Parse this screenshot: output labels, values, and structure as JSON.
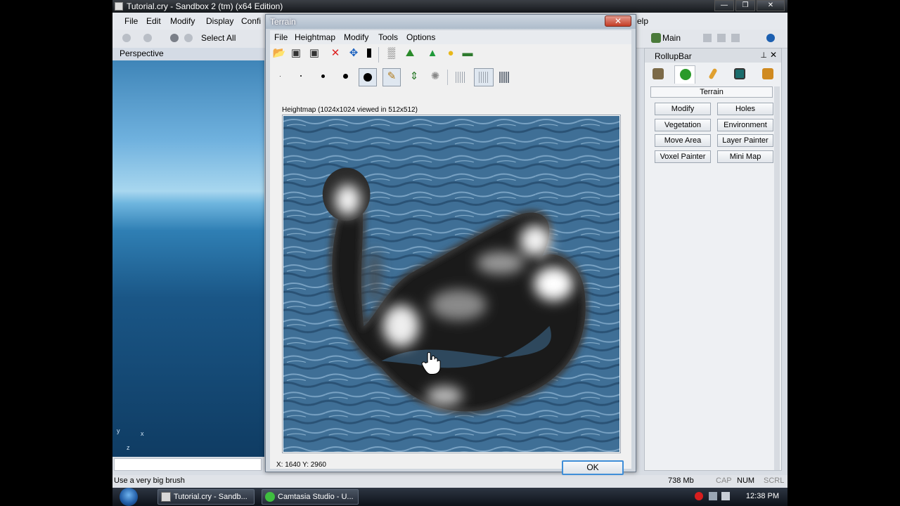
{
  "app": {
    "title": "Tutorial.cry - Sandbox 2 (tm) (x64 Edition)",
    "menus": [
      "File",
      "Edit",
      "Modify",
      "Display",
      "Confi",
      "elp"
    ],
    "toolbar": {
      "select_all": "Select All",
      "main_label": "Main"
    },
    "viewport_label": "Perspective",
    "axis": {
      "y": "y",
      "x": "x",
      "z": "z"
    },
    "status": {
      "text": "Use a very big brush",
      "memory": "738 Mb",
      "cap": "CAP",
      "num": "NUM",
      "scrl": "SCRL"
    }
  },
  "rollup": {
    "title": "RollupBar",
    "section": "Terrain",
    "buttons": [
      "Modify",
      "Holes",
      "Vegetation",
      "Environment",
      "Move Area",
      "Layer Painter",
      "Voxel Painter",
      "Mini Map"
    ]
  },
  "terrain_dialog": {
    "title": "Terrain",
    "close_glyph": "✕",
    "menus": [
      "File",
      "Heightmap",
      "Modify",
      "Tools",
      "Options"
    ],
    "caption": "Heightmap (1024x1024 viewed in 512x512)",
    "coords": "X: 1640 Y: 2960",
    "ok": "OK"
  },
  "taskbar": {
    "items": [
      "Tutorial.cry - Sandb...",
      "Camtasia Studio - U..."
    ],
    "clock": "12:38 PM"
  },
  "colors": {
    "water": "#3f6f96",
    "accent": "#3f8ed8",
    "close_red": "#c43c25"
  }
}
